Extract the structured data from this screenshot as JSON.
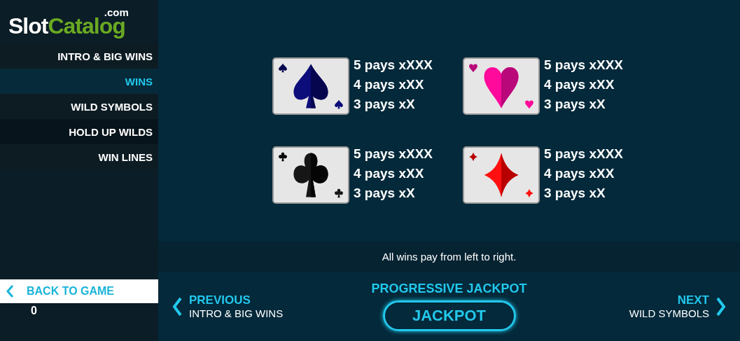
{
  "logo": {
    "first": "Slot",
    "second": "Catalog",
    "suffix": ".com"
  },
  "menu": [
    {
      "label": "INTRO & BIG WINS",
      "selected": false
    },
    {
      "label": "WINS",
      "selected": true
    },
    {
      "label": "WILD SYMBOLS",
      "selected": false
    },
    {
      "label": "HOLD UP WILDS",
      "selected": false
    },
    {
      "label": "WIN LINES",
      "selected": false
    }
  ],
  "back": {
    "label": "BACK TO GAME",
    "value": "0"
  },
  "symbols": [
    {
      "kind": "spade",
      "pays": [
        "5 pays xXXX",
        "4 pays xXX",
        "3 pays xX"
      ]
    },
    {
      "kind": "heart",
      "pays": [
        "5 pays xXXX",
        "4 pays xXX",
        "3 pays xX"
      ]
    },
    {
      "kind": "club",
      "pays": [
        "5 pays xXXX",
        "4 pays xXX",
        "3 pays xX"
      ]
    },
    {
      "kind": "diamond",
      "pays": [
        "5 pays xXXX",
        "4 pays xXX",
        "3 pays xX"
      ]
    }
  ],
  "note": "All wins pay from left to right.",
  "previous": {
    "label": "PREVIOUS",
    "page": "INTRO & BIG WINS"
  },
  "jackpot": {
    "title": "PROGRESSIVE JACKPOT",
    "value": "JACKPOT"
  },
  "next": {
    "label": "NEXT",
    "page": "WILD SYMBOLS"
  }
}
